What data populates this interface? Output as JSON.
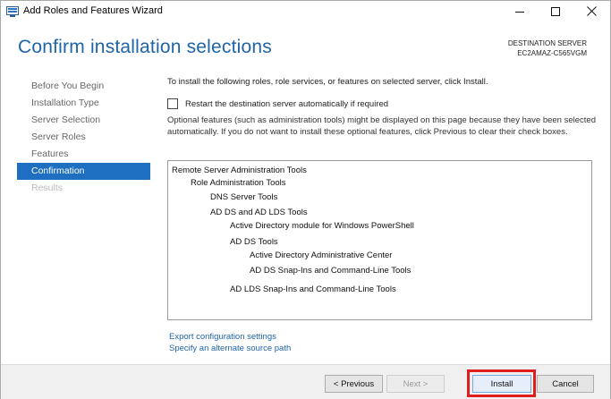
{
  "window": {
    "title": "Add Roles and Features Wizard",
    "icon": "server-manager-icon",
    "controls": [
      "minimize-icon",
      "maximize-icon",
      "close-icon"
    ]
  },
  "header": {
    "title": "Confirm installation selections",
    "destination_label": "DESTINATION SERVER",
    "destination_name": "EC2AMAZ-C565VGM"
  },
  "sidebar": {
    "items": [
      {
        "label": "Before You Begin",
        "state": "normal"
      },
      {
        "label": "Installation Type",
        "state": "normal"
      },
      {
        "label": "Server Selection",
        "state": "normal"
      },
      {
        "label": "Server Roles",
        "state": "normal"
      },
      {
        "label": "Features",
        "state": "normal"
      },
      {
        "label": "Confirmation",
        "state": "active"
      },
      {
        "label": "Results",
        "state": "disabled"
      }
    ]
  },
  "main": {
    "intro": "To install the following roles, role services, or features on selected server, click Install.",
    "restart_checkbox": {
      "label": "Restart the destination server automatically if required",
      "checked": false
    },
    "optional_note": "Optional features (such as administration tools) might be displayed on this page because they have been selected automatically. If you do not want to install these optional features, click Previous to clear their check boxes.",
    "selections": [
      {
        "text": "Remote Server Administration Tools",
        "level": 0
      },
      {
        "text": "Role Administration Tools",
        "level": 1
      },
      {
        "text": "DNS Server Tools",
        "level": 2
      },
      {
        "text": "AD DS and AD LDS Tools",
        "level": 2
      },
      {
        "text": "Active Directory module for Windows PowerShell",
        "level": 3
      },
      {
        "text": "AD DS Tools",
        "level": 3
      },
      {
        "text": "Active Directory Administrative Center",
        "level": 4
      },
      {
        "text": "AD DS Snap-Ins and Command-Line Tools",
        "level": 4
      },
      {
        "text": "AD LDS Snap-Ins and Command-Line Tools",
        "level": 3
      }
    ],
    "links": {
      "export": "Export configuration settings",
      "alternate_source": "Specify an alternate source path"
    }
  },
  "footer": {
    "previous": "< Previous",
    "next": "Next >",
    "install": "Install",
    "cancel": "Cancel"
  },
  "colors": {
    "accent": "#1e6fc2",
    "title_blue": "#1e64a8",
    "highlight_red": "#e01d1d"
  }
}
